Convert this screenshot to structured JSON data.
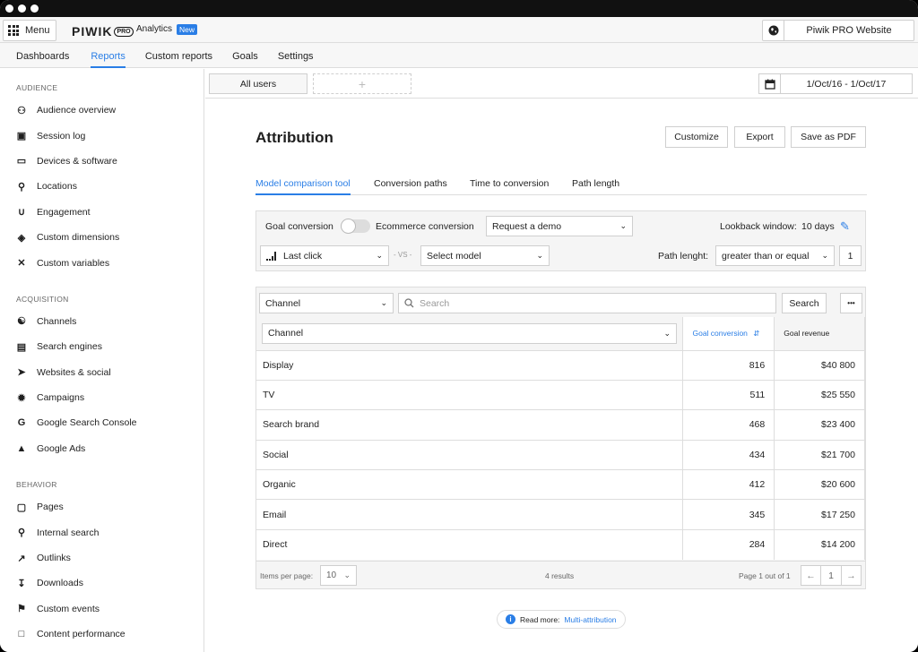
{
  "topbar": {
    "menu_label": "Menu",
    "logo_text": "PIWIK",
    "logo_pro": "PRO",
    "analytics_label": "Analytics",
    "new_badge": "New",
    "site_label": "Piwik PRO Website"
  },
  "nav": [
    "Dashboards",
    "Reports",
    "Custom reports",
    "Goals",
    "Settings"
  ],
  "nav_active": "Reports",
  "sidebar": {
    "audience_title": "AUDIENCE",
    "audience": [
      {
        "label": "Audience overview",
        "icon": "users-icon"
      },
      {
        "label": "Session log",
        "icon": "id-card-icon"
      },
      {
        "label": "Devices & software",
        "icon": "laptop-icon"
      },
      {
        "label": "Locations",
        "icon": "pin-icon"
      },
      {
        "label": "Engagement",
        "icon": "magnet-icon"
      },
      {
        "label": "Custom dimensions",
        "icon": "cube-icon"
      },
      {
        "label": "Custom variables",
        "icon": "variable-icon"
      }
    ],
    "acquisition_title": "ACQUISITION",
    "acquisition": [
      {
        "label": "Channels",
        "icon": "network-icon"
      },
      {
        "label": "Search engines",
        "icon": "search-page-icon"
      },
      {
        "label": "Websites & social",
        "icon": "cursor-icon"
      },
      {
        "label": "Campaigns",
        "icon": "burst-icon"
      },
      {
        "label": "Google Search Console",
        "icon": "google-icon"
      },
      {
        "label": "Google Ads",
        "icon": "google-ads-icon"
      }
    ],
    "behavior_title": "BEHAVIOR",
    "behavior": [
      {
        "label": "Pages",
        "icon": "window-icon"
      },
      {
        "label": "Internal search",
        "icon": "search-icon"
      },
      {
        "label": "Outlinks",
        "icon": "external-link-icon"
      },
      {
        "label": "Downloads",
        "icon": "download-icon"
      },
      {
        "label": "Custom events",
        "icon": "flag-icon"
      },
      {
        "label": "Content performance",
        "icon": "document-icon"
      }
    ]
  },
  "segments": {
    "all_users": "All users",
    "add": "+"
  },
  "date_range": "1/Oct/16 - 1/Oct/17",
  "page": {
    "title": "Attribution",
    "customize": "Customize",
    "export": "Export",
    "save_pdf": "Save as PDF"
  },
  "tabs": [
    "Model comparison tool",
    "Conversion paths",
    "Time to conversion",
    "Path length"
  ],
  "filters": {
    "goal_conversion": "Goal conversion",
    "ecommerce_conversion": "Ecommerce conversion",
    "goal_select": "Request a demo",
    "lookback_label": "Lookback window:",
    "lookback_value": "10 days",
    "model_a": "Last click",
    "vs": "- VS -",
    "model_b": "Select model",
    "path_label": "Path lenght:",
    "path_operator": "greater than or equal",
    "path_value": "1"
  },
  "table": {
    "dimension_select": "Channel",
    "search_placeholder": "Search",
    "search_button": "Search",
    "more": "•••",
    "col_dimension": "Channel",
    "col_goal_conv": "Goal conversion",
    "col_goal_rev": "Goal revenue",
    "rows": [
      {
        "name": "Display",
        "conv": "816",
        "rev": "$40 800"
      },
      {
        "name": "TV",
        "conv": "511",
        "rev": "$25 550"
      },
      {
        "name": "Search brand",
        "conv": "468",
        "rev": "$23 400"
      },
      {
        "name": "Social",
        "conv": "434",
        "rev": "$21 700"
      },
      {
        "name": "Organic",
        "conv": "412",
        "rev": "$20 600"
      },
      {
        "name": "Email",
        "conv": "345",
        "rev": "$17 250"
      },
      {
        "name": "Direct",
        "conv": "284",
        "rev": "$14 200"
      }
    ],
    "items_per_page_label": "Items per page:",
    "items_per_page": "10",
    "results": "4 results",
    "page_info": "Page 1 out of 1",
    "page_number": "1"
  },
  "read_more": {
    "label": "Read more:",
    "link": "Multi-attribution"
  },
  "colors": {
    "accent": "#2a7ee6"
  }
}
